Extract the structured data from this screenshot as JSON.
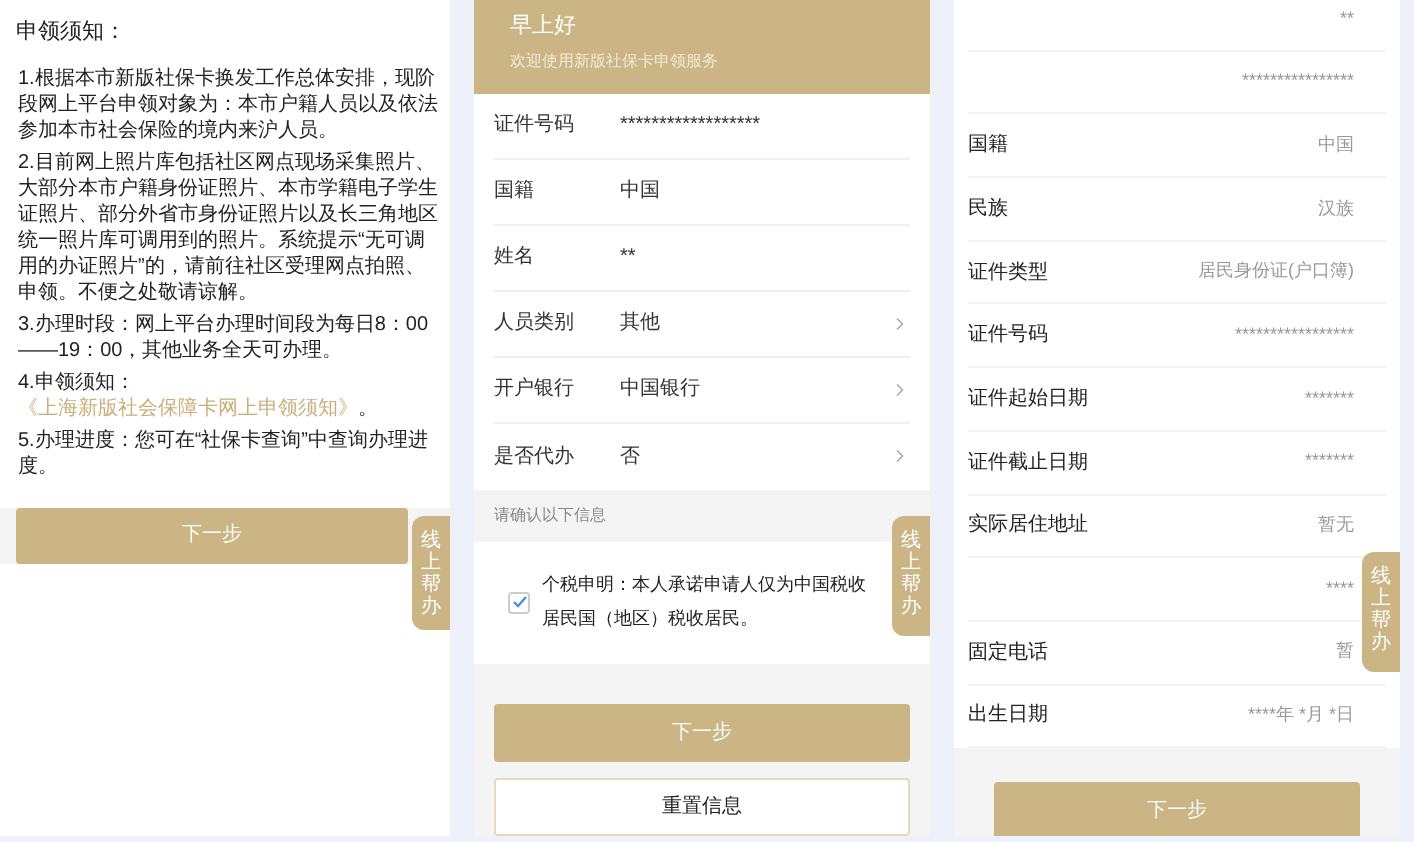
{
  "panels": [
    {
      "kind": "notice",
      "title": "申领须知：",
      "paragraphs": [
        {
          "text": "1.根据本市新版社保卡换发工作总体安排，现阶段网上平台申领对象为：本市户籍人员以及依法参加本市社会保险的境内来沪人员。"
        },
        {
          "text": "2.目前网上照片库包括社区网点现场采集照片、大部分本市户籍身份证照片、本市学籍电子学生证照片、部分外省市身份证照片以及长三角地区统一照片库可调用到的照片。系统提示“无可调用的办证照片”的，请前往社区受理网点拍照、申领。不便之处敬请谅解。"
        },
        {
          "text": "3.办理时段：网上平台办理时间段为每日8：00——19：00，其他业务全天可办理。"
        },
        {
          "text": "4.申领须知：",
          "link": "《上海新版社会保障卡网上申领须知》",
          "after": "。"
        },
        {
          "text": "5.办理进度：您可在“社保卡查询”中查询办理进度。"
        }
      ],
      "next_button": "下一步",
      "help_tab": "线上帮办"
    },
    {
      "kind": "form",
      "greeting": "早上好",
      "subtitle": "欢迎使用新版社保卡申领服务",
      "fields": [
        {
          "label": "证件号码",
          "value": "******************",
          "arrow": false
        },
        {
          "label": "国籍",
          "value": "中国",
          "arrow": false
        },
        {
          "label": "姓名",
          "value": "**",
          "arrow": false
        },
        {
          "label": "人员类别",
          "value": "其他",
          "arrow": true
        },
        {
          "label": "开户银行",
          "value": "中国银行",
          "arrow": true
        },
        {
          "label": "是否代办",
          "value": "否",
          "arrow": true
        }
      ],
      "confirm_heading": "请确认以下信息",
      "declaration": {
        "checked": true,
        "text": "个税申明：本人承诺申请人仅为中国税收居民国（地区）税收居民。"
      },
      "next_button": "下一步",
      "reset_button": "重置信息",
      "help_tab": "线上帮办"
    },
    {
      "kind": "details",
      "rows": [
        {
          "value": "**"
        },
        {
          "value": "****************"
        },
        {
          "label": "国籍",
          "value": "中国"
        },
        {
          "label": "民族",
          "value": "汉族"
        },
        {
          "label": "证件类型",
          "value": "居民身份证(户口簿)"
        },
        {
          "label": "证件号码",
          "value": "*****************"
        },
        {
          "label": "证件起始日期",
          "value": "*******"
        },
        {
          "label": "证件截止日期",
          "value": "*******"
        },
        {
          "label": "实际居住地址",
          "value": "暂无"
        },
        {
          "value": "****"
        },
        {
          "label": "固定电话",
          "value": "暂"
        },
        {
          "label": "出生日期",
          "value": "****年 *月 *日"
        }
      ],
      "next_button": "下一步",
      "help_tab": "线上帮办"
    }
  ]
}
